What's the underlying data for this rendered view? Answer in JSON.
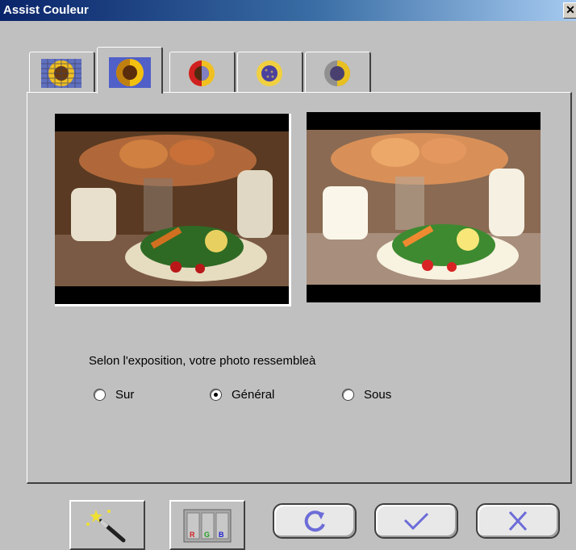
{
  "window": {
    "title": "Assist Couleur",
    "close_symbol": "✕"
  },
  "tabs": [
    {
      "icon": "sunflower-grid-icon",
      "active": false
    },
    {
      "icon": "sunflower-exposure-icon",
      "active": true
    },
    {
      "icon": "sunflower-halves-icon",
      "active": false
    },
    {
      "icon": "sunflower-saturation-icon",
      "active": false
    },
    {
      "icon": "sunflower-gray-icon",
      "active": false
    }
  ],
  "main": {
    "prompt": "Selon l'exposition, votre photo ressembleà",
    "options": [
      {
        "label": "Sur",
        "checked": false
      },
      {
        "label": "Général",
        "checked": true
      },
      {
        "label": "Sous",
        "checked": false
      }
    ],
    "rgb_letters": [
      "R",
      "G",
      "B"
    ]
  },
  "buttons": [
    "magic-wand-icon",
    "rgb-icon",
    "reset-icon",
    "check-icon",
    "x-icon"
  ],
  "colors": {
    "titlebar_start": "#0a246a",
    "dialog_bg": "#c0c0c0",
    "button_accent": "#6c6cd8"
  }
}
